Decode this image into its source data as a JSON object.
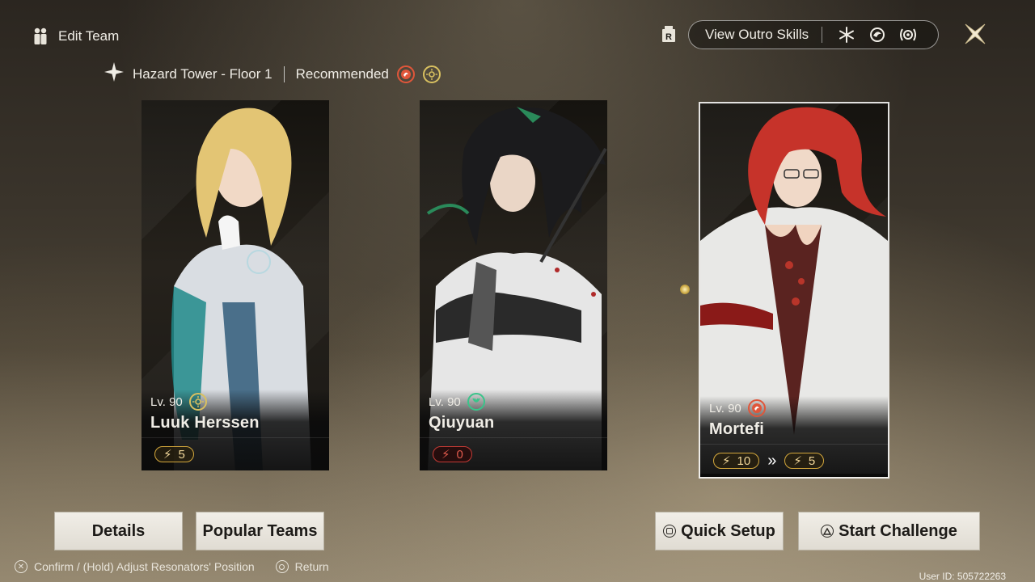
{
  "header": {
    "title": "Edit Team",
    "outro_label": "View Outro Skills",
    "outro_icons": [
      "snowflake-element-icon",
      "wind-element-icon",
      "laurel-element-icon"
    ]
  },
  "stage": {
    "name": "Hazard Tower - Floor 1",
    "recommended_label": "Recommended",
    "recommended_elements": [
      "fusion",
      "spectro"
    ]
  },
  "team": [
    {
      "level": "Lv. 90",
      "name": "Luuk Herssen",
      "element": "spectro",
      "energy": [
        "5"
      ],
      "energy_color": "#d3a73c"
    },
    {
      "level": "Lv. 90",
      "name": "Qiuyuan",
      "element": "aero",
      "energy": [
        "0"
      ],
      "energy_color": "#c43a35"
    },
    {
      "level": "Lv. 90",
      "name": "Mortefi",
      "element": "fusion",
      "energy": [
        "10",
        "5"
      ],
      "energy_color": "#d3a73c",
      "selected": true
    }
  ],
  "buttons": {
    "details": "Details",
    "popular_teams": "Popular Teams",
    "quick_setup": "Quick Setup",
    "start_challenge": "Start Challenge"
  },
  "hints": {
    "confirm": "Confirm / (Hold) Adjust Resonators' Position",
    "return": "Return"
  },
  "user_id": "User ID: 505722263"
}
